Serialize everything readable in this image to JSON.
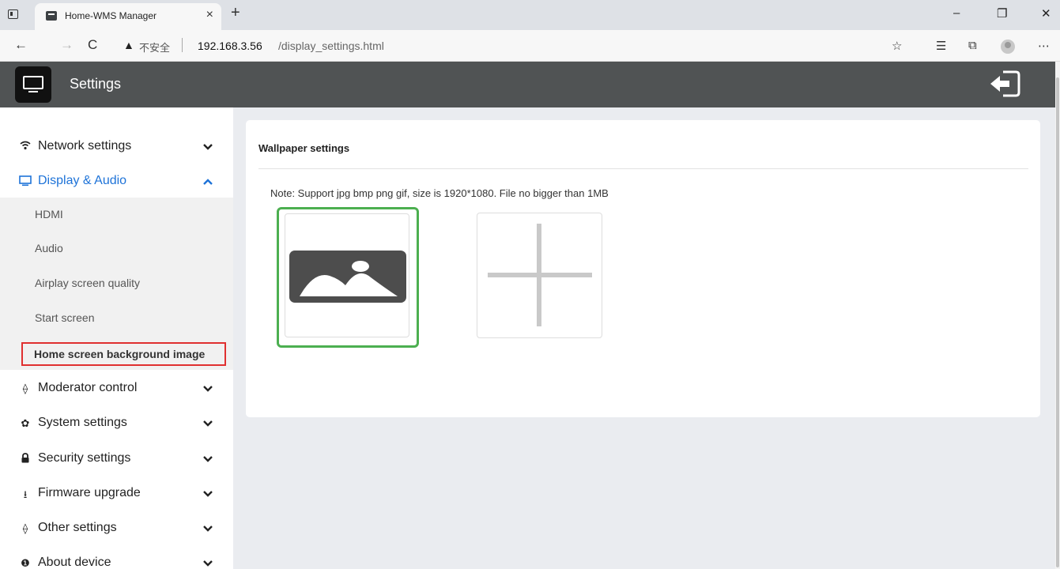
{
  "browser": {
    "tab_title": "Home-WMS Manager",
    "tab_close": "×",
    "new_tab": "+",
    "url_warning_icon": "▲",
    "url_insecure": "不安全",
    "url_host": "192.168.3.56",
    "url_path": "/display_settings.html",
    "window_controls": [
      "–",
      "❐",
      "✕"
    ],
    "nav": {
      "back": "←",
      "forward": "→",
      "reload": "C"
    },
    "toolbar_icons": [
      "☆",
      "☰",
      "⧉",
      "⋯"
    ]
  },
  "app": {
    "title": "Settings",
    "logo_icon": "screen-cast-icon",
    "logout_icon": "sign-out-icon"
  },
  "sidebar": {
    "items": [
      {
        "label": "Network settings",
        "icon": "wifi-icon",
        "glyph": "",
        "expanded": false
      },
      {
        "label": "Display & Audio",
        "icon": "monitor-icon",
        "glyph": "",
        "expanded": true
      },
      {
        "label": "Moderator control",
        "icon": "diamond-icon",
        "glyph": "⟠",
        "expanded": false
      },
      {
        "label": "System settings",
        "icon": "gear-icon",
        "glyph": "✿",
        "expanded": false
      },
      {
        "label": "Security settings",
        "icon": "lock-icon",
        "glyph": "",
        "expanded": false
      },
      {
        "label": "Firmware upgrade",
        "icon": "upload-icon",
        "glyph": "⭳",
        "expanded": false
      },
      {
        "label": "Other settings",
        "icon": "diamond-icon",
        "glyph": "⟠",
        "expanded": false
      },
      {
        "label": "About device",
        "icon": "info-icon",
        "glyph": "❶",
        "expanded": false
      }
    ],
    "display_submenu": [
      "HDMI",
      "Audio",
      "Airplay screen quality",
      "Start screen"
    ],
    "selected_submenu": "Home screen background image"
  },
  "main": {
    "card_title": "Wallpaper settings",
    "note": "Note: Support jpg bmp png gif, size is 1920*1080. File no bigger than 1MB",
    "wallpaper_icon": "image-icon",
    "add_icon": "plus-icon"
  },
  "colors": {
    "accent": "#1e73d8",
    "selected_border": "#4caf50",
    "highlight_red": "#e03030",
    "header_bg": "#505354"
  }
}
